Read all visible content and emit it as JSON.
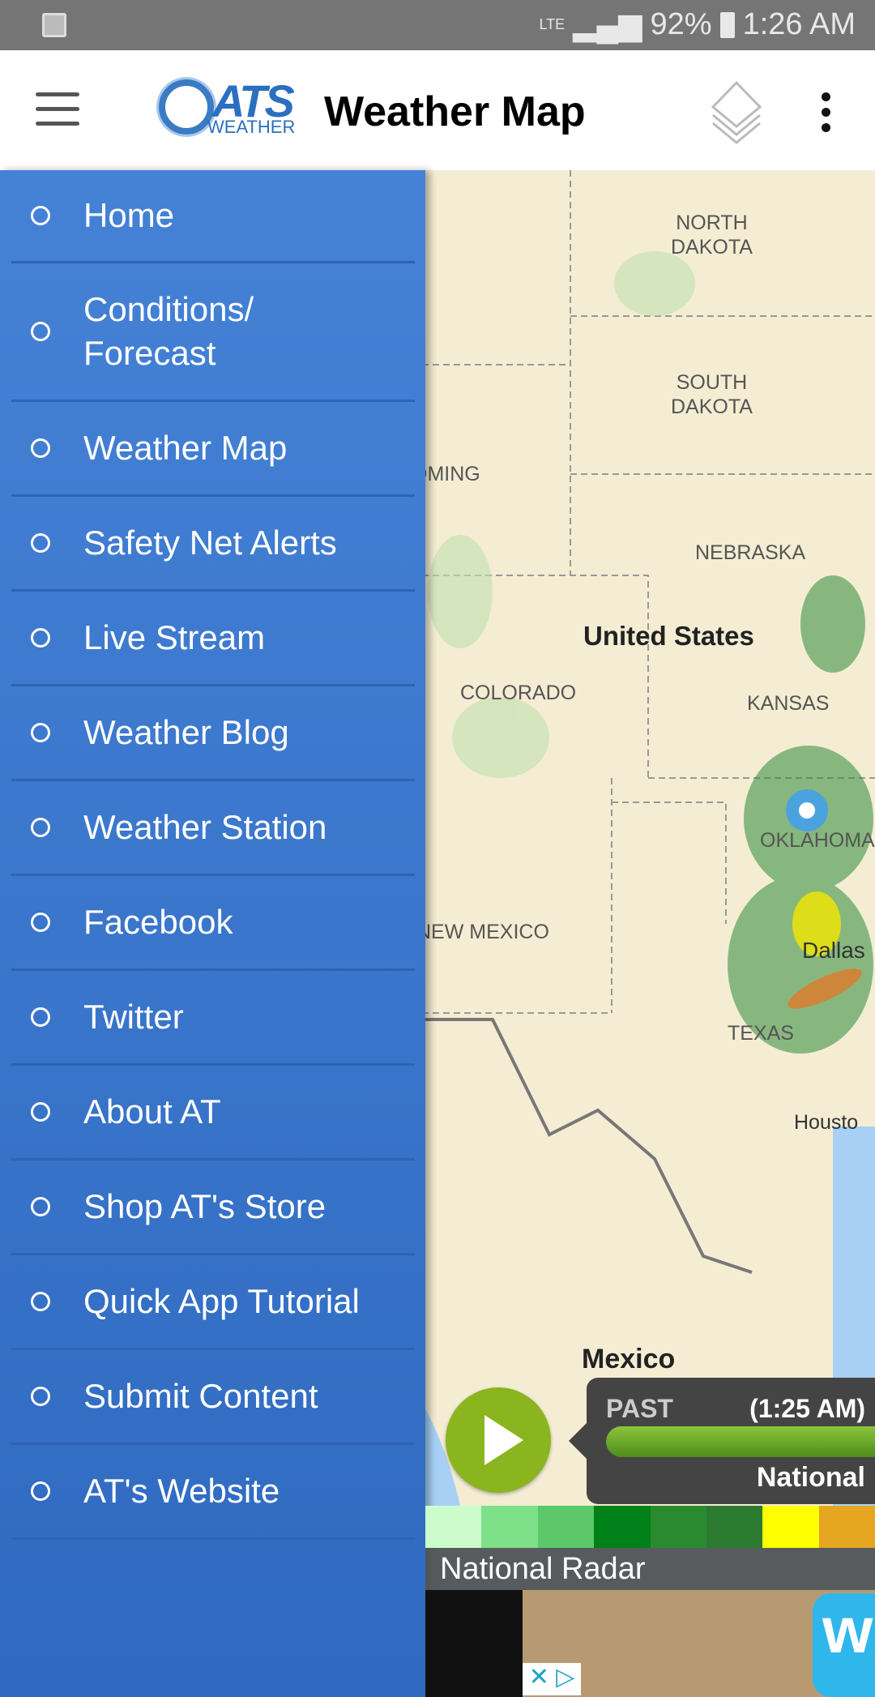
{
  "status": {
    "network": "LTE",
    "battery": "92%",
    "time": "1:26 AM"
  },
  "header": {
    "logo_text": "ATS",
    "logo_sub": "WEATHER",
    "title": "Weather Map"
  },
  "sidebar": {
    "items": [
      {
        "label": "Home"
      },
      {
        "label": "Conditions/\nForecast"
      },
      {
        "label": "Weather Map"
      },
      {
        "label": "Safety Net Alerts"
      },
      {
        "label": "Live Stream"
      },
      {
        "label": "Weather Blog"
      },
      {
        "label": "Weather Station"
      },
      {
        "label": "Facebook"
      },
      {
        "label": "Twitter"
      },
      {
        "label": "About AT"
      },
      {
        "label": "Shop AT's Store"
      },
      {
        "label": "Quick App Tutorial"
      },
      {
        "label": "Submit Content"
      },
      {
        "label": "AT's Website"
      }
    ]
  },
  "map": {
    "labels": [
      "NORTH\nDAKOTA",
      "SOUTH\nDAKOTA",
      "OMING",
      "NEBRASKA",
      "United States",
      "COLORADO",
      "KANSAS",
      "OKLAHOMA",
      "NEW MEXICO",
      "Dallas",
      "TEXAS",
      "Housto",
      "Mexico"
    ]
  },
  "player": {
    "past": "PAST",
    "time": "(1:25 AM)",
    "layer": "National"
  },
  "legend": {
    "colors": [
      "#ccfccc",
      "#7fe08a",
      "#5cc86a",
      "#008018",
      "#2a8a30",
      "#2a7a30",
      "#ffff00",
      "#e6a620"
    ]
  },
  "footer": {
    "label": "National Radar"
  },
  "ad": {
    "brand": "w",
    "choices": "✕ ▷"
  }
}
